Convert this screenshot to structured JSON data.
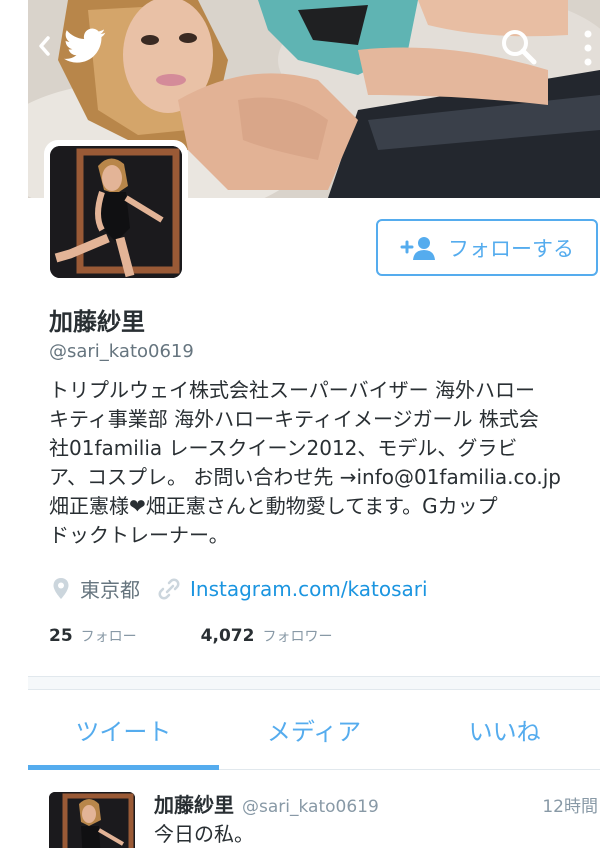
{
  "header": {
    "back_icon": "chevron-left-icon",
    "logo_icon": "twitter-bird-icon",
    "search_icon": "search-icon",
    "more_icon": "vertical-ellipsis-icon"
  },
  "profile": {
    "name": "加藤紗里",
    "handle": "@sari_kato0619",
    "bio_lines": [
      "トリプルウェイ株式会社スーパーバイザー 海外ハロー",
      "キティ事業部 海外ハローキティイメージガール 株式会",
      "社01familia レースクイーン2012、モデル、グラビ",
      "ア、コスプレ。 お問い合わせ先 →info@01familia.co.jp",
      "畑正憲様❤畑正憲さんと動物愛してます。Gカップ",
      "ドックトレーナー。"
    ],
    "location": "東京都",
    "url": "Instagram.com/katosari",
    "following_count": "25",
    "following_label": "フォロー",
    "followers_count": "4,072",
    "followers_label": "フォロワー"
  },
  "follow_button": {
    "label": "フォローする",
    "icon": "add-user-icon"
  },
  "tabs": [
    {
      "label": "ツイート",
      "active": true
    },
    {
      "label": "メディア",
      "active": false
    },
    {
      "label": "いいね",
      "active": false
    }
  ],
  "tweet": {
    "name": "加藤紗里",
    "handle": "@sari_kato0619",
    "time": "12時間",
    "text": "今日の私。"
  },
  "colors": {
    "accent": "#55acee",
    "link": "#1b95e0",
    "text": "#292f33",
    "muted": "#66757f"
  }
}
